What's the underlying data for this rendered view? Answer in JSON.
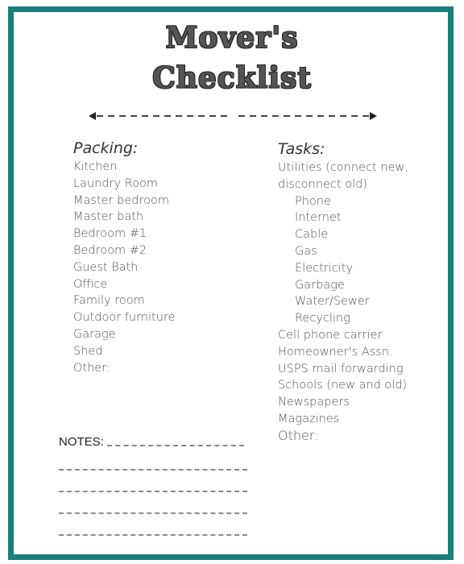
{
  "document": {
    "title_line1": "Mover's",
    "title_line2": "Checklist",
    "border_color": "#1a7f7c"
  },
  "packing": {
    "heading": "Packing:",
    "items": [
      "Kitchen",
      "Laundry Room",
      "Master bedroom",
      "Master bath",
      "Bedroom #1",
      "Bedroom #2",
      "Guest Bath",
      "Office",
      "Family room",
      "Outdoor furniture",
      "Garage",
      "Shed",
      "Other:"
    ]
  },
  "tasks": {
    "heading": "Tasks:",
    "utilities_line1": "Utilities (connect new,",
    "utilities_line2": "disconnect old)",
    "utilities_sub": [
      "Phone",
      "Internet",
      "Cable",
      "Gas",
      "Electricity",
      "Garbage",
      "Water/Sewer",
      "Recycling"
    ],
    "items": [
      "Cell phone carrier",
      "Homeowner's Assn.",
      "USPS mail forwarding",
      "Schools (new and old)",
      "Newspapers",
      "Magazines"
    ],
    "other": "Other:"
  },
  "notes": {
    "label": "NOTES:",
    "line_count": 4
  }
}
